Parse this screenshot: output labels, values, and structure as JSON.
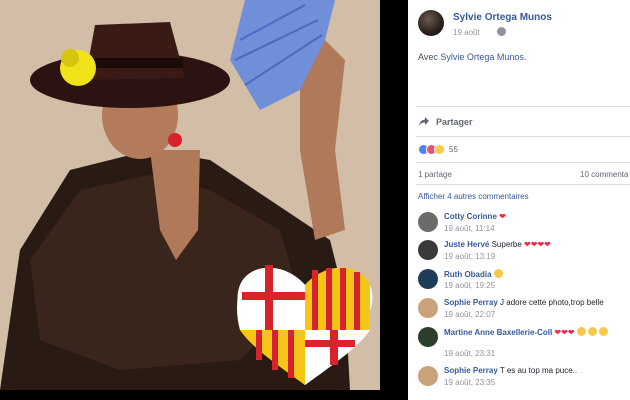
{
  "post": {
    "author": "Sylvie Ortega Munos",
    "date": "19 août",
    "privacy_icon": "globe-icon",
    "text_prefix": "Avec ",
    "tagged": "Sylvie Ortega Munos",
    "text_suffix": "."
  },
  "actions": {
    "share_label": "Partager",
    "share_icon": "share-arrow-icon"
  },
  "reactions": {
    "types": [
      "like",
      "love",
      "sad"
    ],
    "count": "55"
  },
  "stats": {
    "shares": "1 partage",
    "comments": "10 commenta"
  },
  "more_comments": "Afficher 4 autres commentaires",
  "comments": [
    {
      "name": "Cotty Corinne",
      "text": "",
      "hearts": 1,
      "date": "19 août, 11:14",
      "avatar_color": "#6b6b6b"
    },
    {
      "name": "Juste Hervé",
      "text": "Superbe",
      "hearts": 4,
      "date": "19 août, 13:19",
      "avatar_color": "#3a3a3a"
    },
    {
      "name": "Ruth Obadia",
      "text": "",
      "emoji": 1,
      "date": "19 août, 19:25",
      "avatar_color": "#1f3d5a"
    },
    {
      "name": "Sophie Perray",
      "text": "J adore cette photo,trop belle",
      "date": "19 août, 22:07",
      "avatar_color": "#caa27a"
    },
    {
      "name": "Martine Anne Baxellerie-Coll",
      "text": "",
      "hearts": 3,
      "emoji": 3,
      "date": "19 août, 23:31",
      "avatar_color": "#2c3e2c"
    },
    {
      "name": "Sophie Perray",
      "text": "T es au top ma puce..",
      "date": "19 août, 23:35",
      "avatar_color": "#caa27a"
    }
  ],
  "colors": {
    "link": "#365899",
    "muted": "#90949c",
    "heart": "#f0284a"
  }
}
